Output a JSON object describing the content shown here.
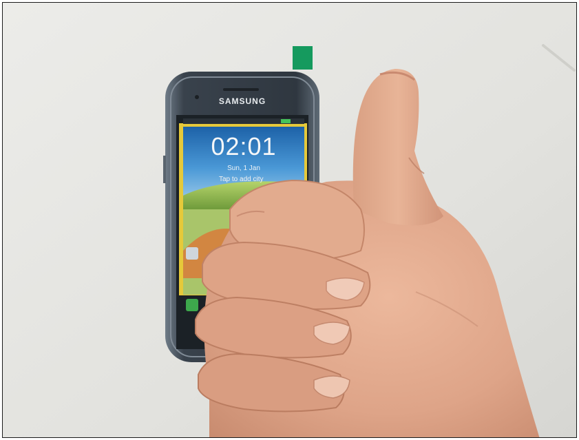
{
  "phone": {
    "brand": "SAMSUNG",
    "lockscreen": {
      "time": "02:01",
      "date": "Sun, 1 Jan",
      "hint": "Tap to add city"
    }
  },
  "colors": {
    "background": "#e4e4e0",
    "phone_body": "#3d4650",
    "screen_sky": "#2f7fc1",
    "screen_bezel": "#e6c93a",
    "sticker": "#159a5e",
    "skin": "#e2ab8e"
  }
}
